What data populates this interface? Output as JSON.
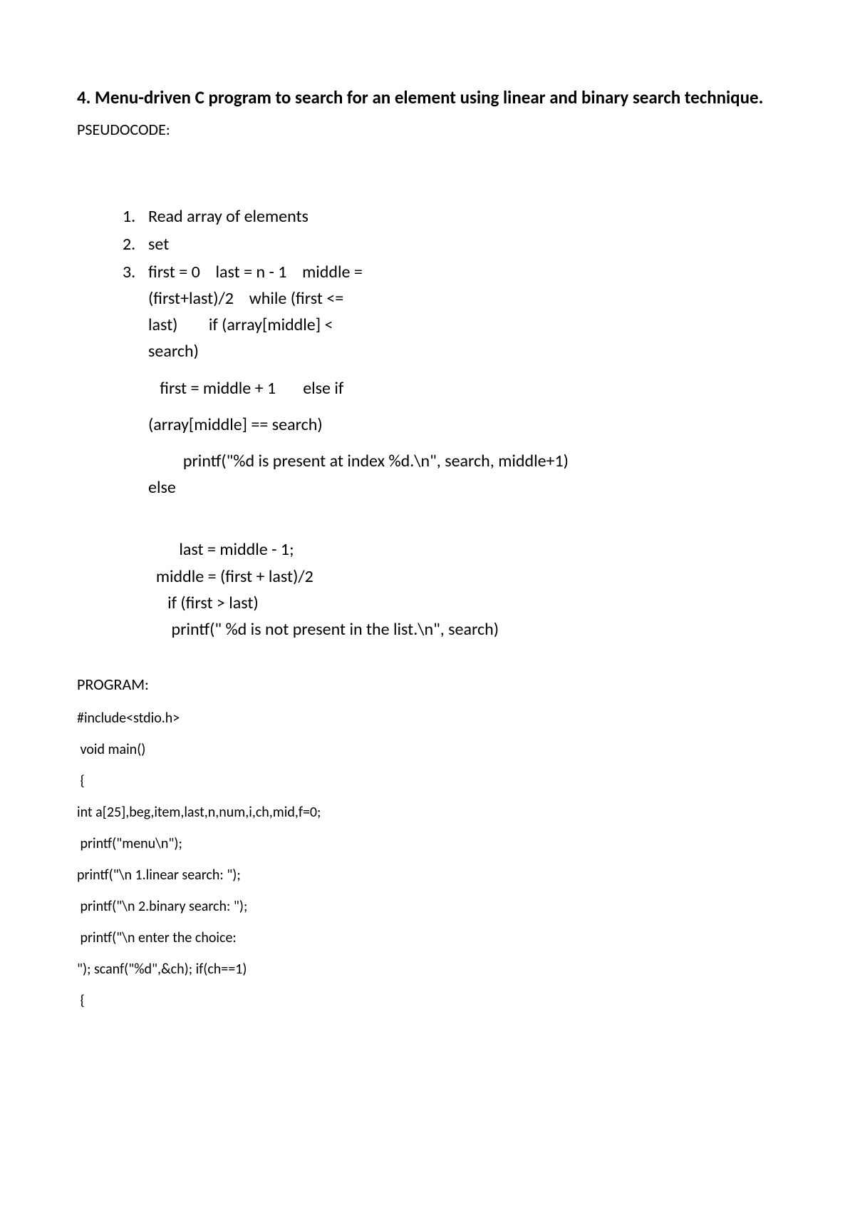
{
  "title": "4. Menu-driven C program to search for an element using linear and binary search technique.",
  "pseudocode_label": "PSEUDOCODE:",
  "list": {
    "item1": "Read array of elements",
    "item2": "set",
    "item3": "first = 0    last = n - 1    middle =\n(first+last)/2    while (first <= \nlast)        if (array[middle] < \nsearch)  ",
    "item3_sub1": "   first = middle + 1       else if ",
    "item3_sub2": "(array[middle] == search)  ",
    "item3_sub3": "         printf(\"%d is present at index %d.\\n\", search, middle+1)  \nelse  "
  },
  "indent_block": "        last = middle - 1;\n  middle = (first + last)/2\n     if (first > last)\n      printf(\" %d is not present in the list.\\n\", search)",
  "program_label": "PROGRAM:",
  "code": {
    "l1": "#include<stdio.h>",
    "l2": " void main()",
    "l3": " {",
    "l4": "int a[25],beg,item,last,n,num,i,ch,mid,f=0;",
    "l5": " printf(\"menu\\n\");",
    "l6": "printf(\"\\n 1.linear search: \");",
    "l7": " printf(\"\\n 2.binary search: \");",
    "l8": " printf(\"\\n enter the choice: ",
    "l9": "\"); scanf(\"%d\",&ch); if(ch==1)",
    "l10": " {"
  }
}
